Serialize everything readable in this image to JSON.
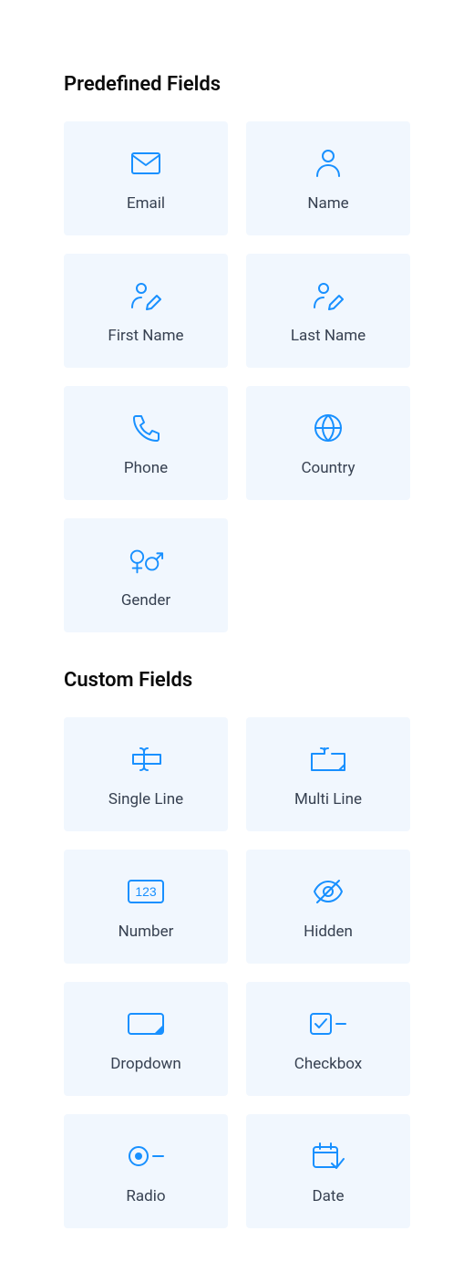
{
  "colors": {
    "accent": "#1890ff",
    "card_bg": "#f1f7fe",
    "label": "#374151"
  },
  "sections": [
    {
      "title": "Predefined Fields",
      "fields": [
        {
          "id": "email",
          "label": "Email",
          "icon": "envelope-icon"
        },
        {
          "id": "name",
          "label": "Name",
          "icon": "person-icon"
        },
        {
          "id": "first-name",
          "label": "First Name",
          "icon": "person-edit-icon"
        },
        {
          "id": "last-name",
          "label": "Last Name",
          "icon": "person-edit-icon"
        },
        {
          "id": "phone",
          "label": "Phone",
          "icon": "phone-icon"
        },
        {
          "id": "country",
          "label": "Country",
          "icon": "globe-icon"
        },
        {
          "id": "gender",
          "label": "Gender",
          "icon": "gender-icon"
        }
      ]
    },
    {
      "title": "Custom Fields",
      "fields": [
        {
          "id": "single-line",
          "label": "Single Line",
          "icon": "text-cursor-icon"
        },
        {
          "id": "multi-line",
          "label": "Multi Line",
          "icon": "textarea-icon"
        },
        {
          "id": "number",
          "label": "Number",
          "icon": "number-box-icon"
        },
        {
          "id": "hidden",
          "label": "Hidden",
          "icon": "eye-off-icon"
        },
        {
          "id": "dropdown",
          "label": "Dropdown",
          "icon": "dropdown-box-icon"
        },
        {
          "id": "checkbox",
          "label": "Checkbox",
          "icon": "checkbox-icon"
        },
        {
          "id": "radio",
          "label": "Radio",
          "icon": "radio-dash-icon"
        },
        {
          "id": "date",
          "label": "Date",
          "icon": "calendar-check-icon"
        }
      ]
    }
  ]
}
